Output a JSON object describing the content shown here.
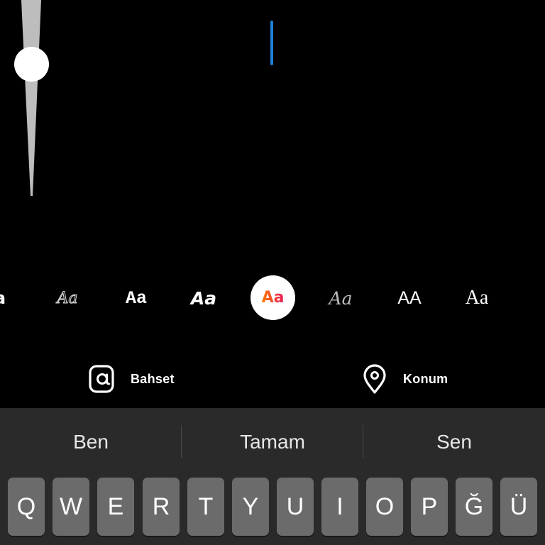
{
  "font_styles": [
    "a",
    "Aa",
    "Aa",
    "Aa",
    "Aa",
    "Aa",
    "AA",
    "Aa"
  ],
  "selected_font_index": 4,
  "actions": {
    "mention": {
      "label": "Bahset",
      "icon": "at-icon"
    },
    "location": {
      "label": "Konum",
      "icon": "location-pin-icon"
    }
  },
  "suggestions": [
    "Ben",
    "Tamam",
    "Sen"
  ],
  "keyboard_row": [
    "Q",
    "W",
    "E",
    "R",
    "T",
    "Y",
    "U",
    "I",
    "O",
    "P",
    "Ğ",
    "Ü"
  ],
  "colors": {
    "caret": "#1d7fd8",
    "keyboard_bg": "#2a2a2a",
    "key_bg": "#6b6b6b",
    "selected_font_gradient": [
      "#ff7a00",
      "#e8185a"
    ]
  }
}
